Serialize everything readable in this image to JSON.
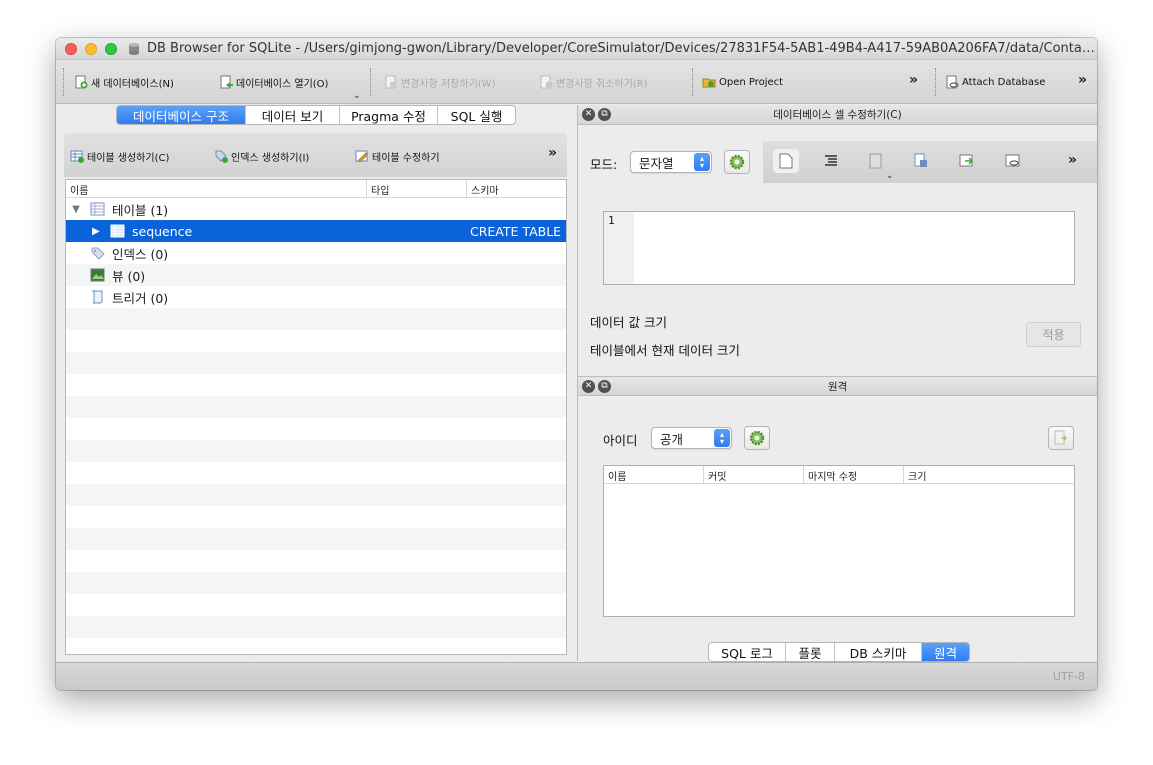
{
  "window": {
    "title": "DB Browser for SQLite - /Users/gimjong-gwon/Library/Developer/CoreSimulator/Devices/27831F54-5AB1-49B4-A417-59AB0A206FA7/data/Containers/Data/A..."
  },
  "toolbar": {
    "new_db": "새 데이터베이스(N)",
    "open_db": "데이터베이스 열기(O)",
    "write_changes": "변경사항 저장하기(W)",
    "revert_changes": "변경사항 취소하기(R)",
    "open_project": "Open Project",
    "more1": "»",
    "attach_db": "Attach Database",
    "more2": "»"
  },
  "tabs": [
    "데이터베이스 구조",
    "데이터 보기",
    "Pragma 수정",
    "SQL 실행"
  ],
  "structure_toolbar": {
    "create_table": "테이블 생성하기(C)",
    "create_index": "인덱스 생성하기(I)",
    "modify_table": "테이블 수정하기",
    "more": "»"
  },
  "tree": {
    "headers": [
      "이름",
      "타입",
      "스키마"
    ],
    "rows": [
      {
        "arrow": "▼",
        "label": "테이블 (1)",
        "schema": ""
      },
      {
        "arrow": "▶",
        "label": "sequence",
        "schema": "CREATE TABLE"
      },
      {
        "arrow": "",
        "label": "인덱스 (0)",
        "schema": ""
      },
      {
        "arrow": "",
        "label": "뷰 (0)",
        "schema": ""
      },
      {
        "arrow": "",
        "label": "트리거 (0)",
        "schema": ""
      }
    ]
  },
  "edit_cell": {
    "title": "데이터베이스 셀 수정하기(C)",
    "mode_label": "모드:",
    "mode_value": "문자열",
    "more": "»",
    "line_number": "1",
    "data_size_label": "데이터 값 크기",
    "table_size_label": "테이블에서 현재 데이터 크기",
    "apply_button": "적용"
  },
  "remote": {
    "title": "원격",
    "id_label": "아이디",
    "id_value": "공개",
    "headers": [
      "이름",
      "커밋",
      "마지막 수정",
      "크기"
    ]
  },
  "bottom_tabs": [
    "SQL 로그",
    "플롯",
    "DB 스키마",
    "원격"
  ],
  "status": {
    "encoding": "UTF-8"
  }
}
